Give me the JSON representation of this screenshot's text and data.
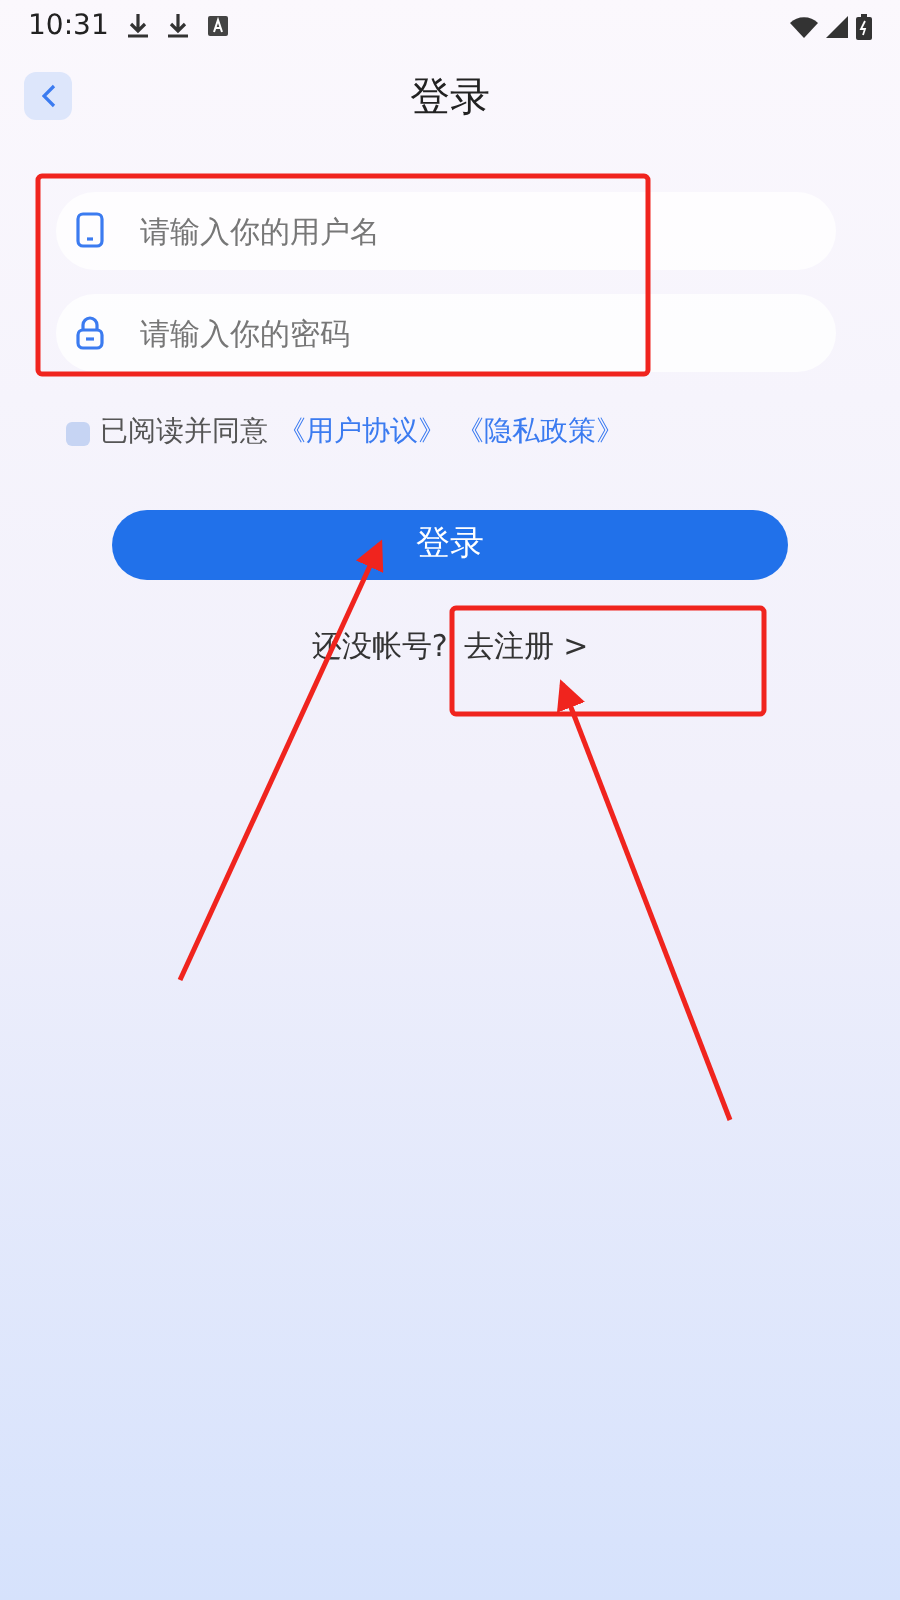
{
  "status_bar": {
    "time": "10:31"
  },
  "header": {
    "title": "登录"
  },
  "fields": [
    {
      "kind": "phone",
      "placeholder": "请输入你的用户名"
    },
    {
      "kind": "lock",
      "placeholder": "请输入你的密码"
    }
  ],
  "agreement": {
    "checked": false,
    "text": "已阅读并同意",
    "links": [
      "《用户协议》",
      "《隐私政策》"
    ]
  },
  "login_button": "登录",
  "register": {
    "prompt": "还没帐号?",
    "link": "去注册 >"
  }
}
